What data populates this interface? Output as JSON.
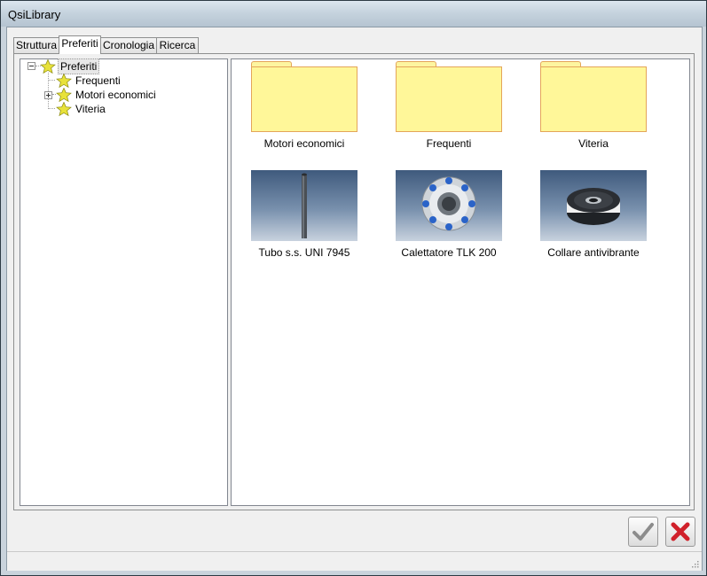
{
  "window": {
    "title": "QsiLibrary"
  },
  "tabs": [
    {
      "label": "Struttura"
    },
    {
      "label": "Preferiti"
    },
    {
      "label": "Cronologia"
    },
    {
      "label": "Ricerca"
    }
  ],
  "active_tab": "Preferiti",
  "tree": {
    "root": {
      "label": "Preferiti",
      "expanded": true,
      "selected": true
    },
    "children": [
      {
        "label": "Frequenti",
        "has_children": false
      },
      {
        "label": "Motori economici",
        "has_children": true
      },
      {
        "label": "Viteria",
        "has_children": false
      }
    ]
  },
  "items": [
    {
      "label": "Motori economici",
      "kind": "folder"
    },
    {
      "label": "Frequenti",
      "kind": "folder"
    },
    {
      "label": "Viteria",
      "kind": "folder"
    },
    {
      "label": "Tubo s.s. UNI 7945",
      "kind": "part"
    },
    {
      "label": "Calettatore TLK 200",
      "kind": "part"
    },
    {
      "label": "Collare antivibrante",
      "kind": "part"
    }
  ],
  "buttons": {
    "ok_icon": "checkmark-icon",
    "cancel_icon": "red-x-icon"
  },
  "colors": {
    "folder": "#fff799",
    "cancel": "#d0202a",
    "ok": "#8c8c8c"
  }
}
